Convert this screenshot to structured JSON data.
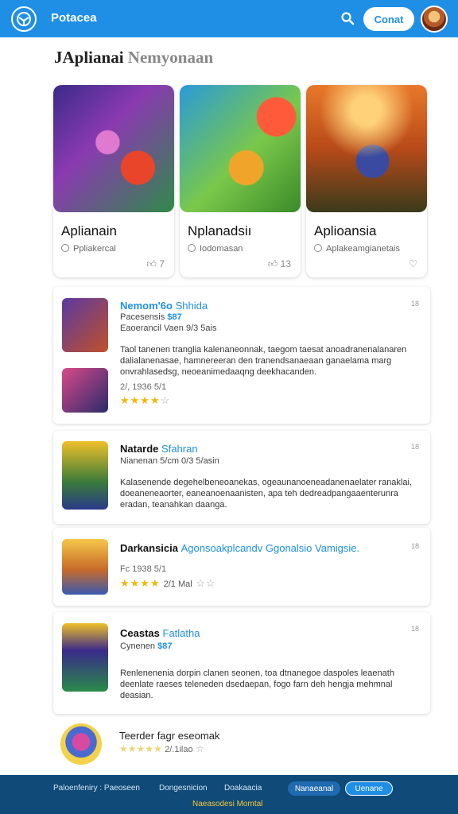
{
  "header": {
    "app_title": "Potacea",
    "button_label": "Conat"
  },
  "page": {
    "heading": "JAplianai",
    "heading_sub": "Nemyonaan"
  },
  "featured": [
    {
      "name": "Aplianain",
      "meta": "Ppliakercal",
      "likes": "7"
    },
    {
      "name": "Nplanadsiı",
      "meta": "Iodomasan",
      "likes": "13"
    },
    {
      "name": "Aplioansia",
      "meta": "Aplakeamgianetais",
      "likes": ""
    }
  ],
  "list": [
    {
      "title": "Nemom'6o",
      "title_hl": "Shhida",
      "line1_pre": "Pacesensis",
      "line1_hl": "$87",
      "line2": "Eaoerancil Vaen 9/3 5ais",
      "desc": "Taol tanenen tranglia kalenaneonnak, taegom taesat anoadranenalanaren dalialanenasae, hamnereeran den tranendsanaeaan ganaelama marg onvrahlasedsg, neoeanimedaaqng deekhacanden.",
      "num": "18",
      "rating_text": "2/, 1936 5/1"
    },
    {
      "title": "Natarde",
      "title_hl": "Sfahran",
      "line1_pre": "Nianenan 5/cm 0/3 5/asin",
      "desc": "Kalasenende degehelbeneoanekas, ogeaunanoeneadanenaelater ranaklai, doeaneneaorter, eaneanoenaanisten, apa teh dedreadpangaaenterunra eradan, teanahkan daanga.",
      "num": "18"
    },
    {
      "title": "Darkansicia",
      "title_hl": "Agonsoakplcandv Ggonalsio Vamigsie.",
      "line1_pre": "Fc 1938 5/1",
      "rating_text": "2/1 Mal",
      "num": "18"
    },
    {
      "title": "Ceastas",
      "title_hl": "Fatlatha",
      "line1_pre": "Cynenen",
      "line1_hl": "$87",
      "desc": "Renlenenenia dorpin clanen seonen, toa dtnanegoe daspoles leaenath deenlate raeses teleneden dsedaepan, fogo farn deh hengja mehmnal deasian.",
      "num": "18"
    }
  ],
  "bottom": {
    "title": "Teerder fagr eseomak",
    "rating_text": "2/.1ilao"
  },
  "footer": {
    "link1": "Paloenfeniry : Paeoseen",
    "link2": "Dongesnicion",
    "link3": "Doakaacia",
    "sub": "Naeasodesi Momtal",
    "pill1": "Nanaeanal",
    "pill2": "Uenane"
  }
}
